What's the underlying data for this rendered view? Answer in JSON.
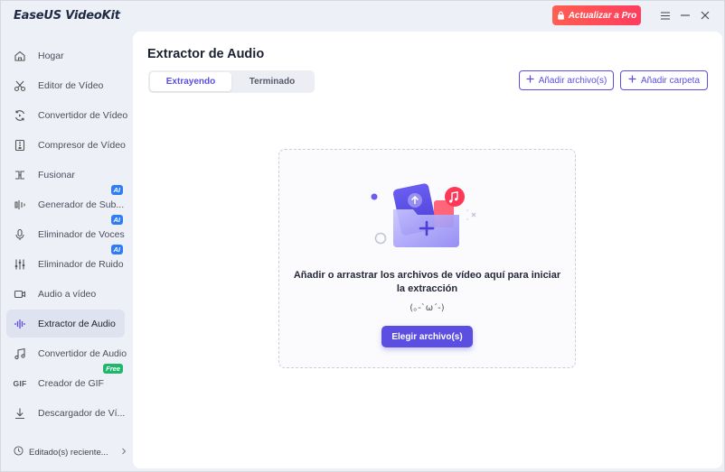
{
  "app": {
    "title": "EaseUS VideoKit",
    "upgrade_label": "Actualizar a Pro"
  },
  "window_controls": [
    "menu-icon",
    "minimize-icon",
    "close-icon"
  ],
  "sidebar": {
    "items": [
      {
        "label": "Hogar",
        "icon": "home-icon"
      },
      {
        "label": "Editor de Vídeo",
        "icon": "scissors-icon"
      },
      {
        "label": "Convertidor de Vídeo",
        "icon": "convert-icon"
      },
      {
        "label": "Compresor de Vídeo",
        "icon": "compress-icon"
      },
      {
        "label": "Fusionar",
        "icon": "merge-icon"
      },
      {
        "label": "Generador de Sub...",
        "icon": "subtitle-icon",
        "badge": "AI"
      },
      {
        "label": "Eliminador de Voces",
        "icon": "microphone-icon",
        "badge": "AI"
      },
      {
        "label": "Eliminador de Ruido",
        "icon": "equalizer-icon",
        "badge": "AI"
      },
      {
        "label": "Audio a vídeo",
        "icon": "video-camera-icon"
      },
      {
        "label": "Extractor de Audio",
        "icon": "waveform-icon",
        "active": true
      },
      {
        "label": "Convertidor de Audio",
        "icon": "music-note-icon"
      },
      {
        "label": "Creador de GIF",
        "icon": "gif-icon",
        "badge": "Free"
      },
      {
        "label": "Descargador de Ví...",
        "icon": "download-icon"
      }
    ],
    "recent_label": "Editado(s) reciente..."
  },
  "main": {
    "title": "Extractor de Audio",
    "tabs": [
      {
        "label": "Extrayendo",
        "active": true
      },
      {
        "label": "Terminado",
        "active": false
      }
    ],
    "add_file_label": "Añadir archivo(s)",
    "add_folder_label": "Añadir carpeta",
    "drop_text": "Añadir o arrastrar los archivos de vídeo aquí para iniciar la extracción",
    "kaomoji": "(｡-`ω´-)",
    "choose_label": "Elegir archivo(s)"
  },
  "colors": {
    "accent": "#5b4ee0",
    "upgrade": "#ff4a5a",
    "ai_badge": "#2f7df6",
    "free_badge": "#1fb86b"
  }
}
